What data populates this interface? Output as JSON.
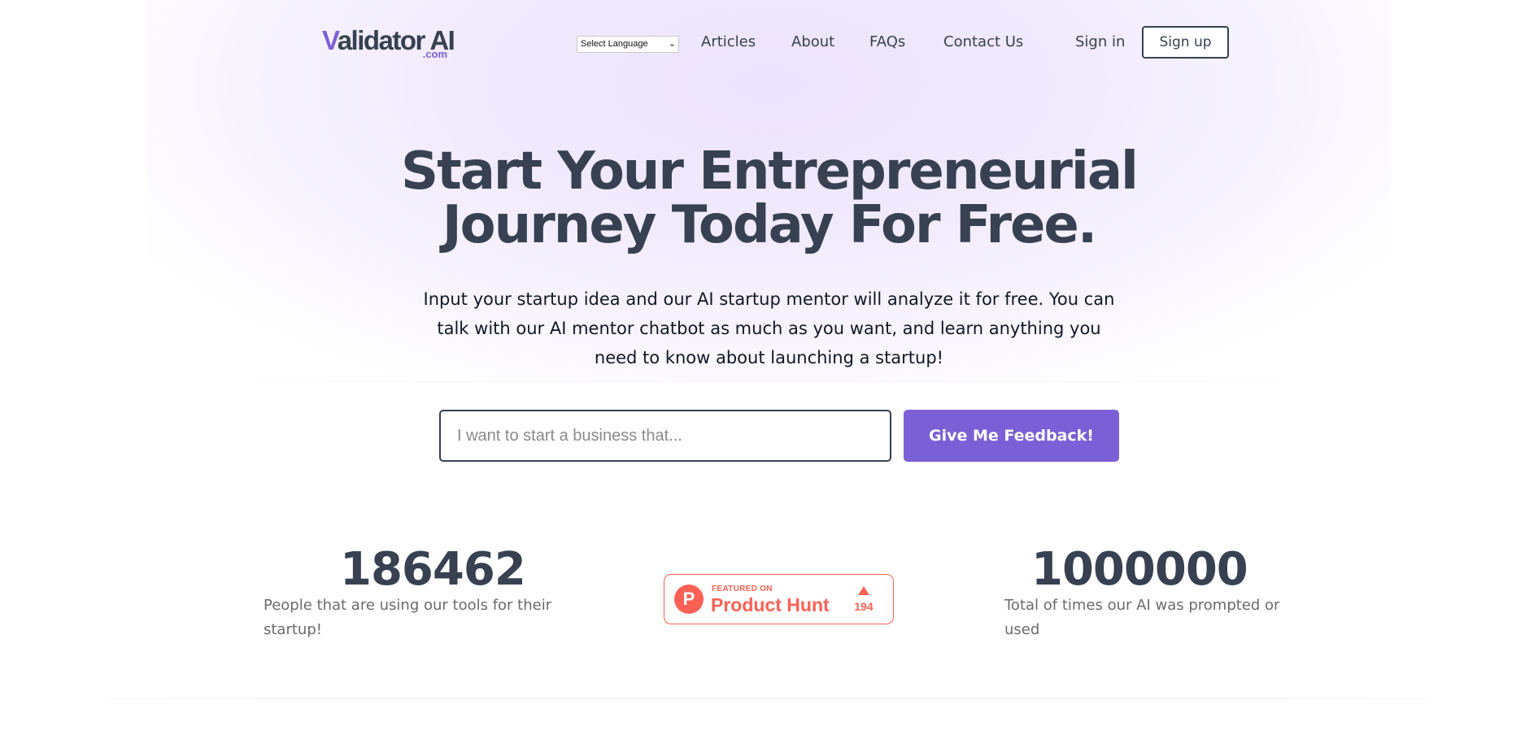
{
  "header": {
    "logo": {
      "prefix": "V",
      "text": "alidator AI",
      "suffix": ".com"
    },
    "language_select": {
      "selected": "Select Language"
    },
    "nav": [
      {
        "label": "Articles"
      },
      {
        "label": "About"
      },
      {
        "label": "FAQs"
      },
      {
        "label": "Contact Us"
      }
    ],
    "sign_in_label": "Sign in",
    "sign_up_label": "Sign up"
  },
  "hero": {
    "title_line1": "Start Your Entrepreneurial",
    "title_line2": "Journey Today For Free.",
    "subtitle": "Input your startup idea and our AI startup mentor will analyze it for free. You can talk with our AI mentor chatbot as much as you want, and learn anything you need to know about launching a startup!",
    "input_placeholder": "I want to start a business that...",
    "input_value": "",
    "button_label": "Give Me Feedback!"
  },
  "stats": [
    {
      "number": "186462",
      "description": "People that are using our tools for their startup!"
    },
    {
      "number": "1000000",
      "description": "Total of times our AI was prompted or used"
    }
  ],
  "product_hunt": {
    "logo_letter": "P",
    "featured_label": "FEATURED ON",
    "name": "Product Hunt",
    "upvotes": "194"
  },
  "colors": {
    "accent": "#7b5fd6",
    "text": "#374151",
    "product_hunt": "#ff6154",
    "hero_tint": "#ece3fd"
  }
}
